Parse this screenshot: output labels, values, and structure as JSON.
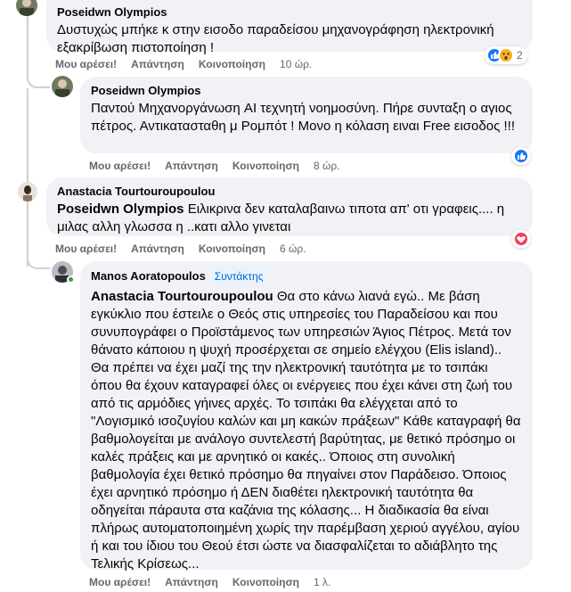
{
  "actions": {
    "like": "Μου αρέσει!",
    "reply": "Απάντηση",
    "share": "Κοινοποίηση"
  },
  "comments": [
    {
      "author": "Poseidwn Olympios",
      "text": "Δυστυχώς μπήκε κ στην εισοδο παραδείσου μηχανογράφηση ηλεκτρονική εξακρίβωση πιστοποίηση !",
      "time": "10 ώρ.",
      "reaction_count": "2"
    },
    {
      "author": "Poseidwn Olympios",
      "text": "Παντού Μηχανοργάνωση AI τεχνητή νοημοσύνη. Πήρε συνταξη ο αγιος πέτρος. Αντικατασταθη μ Ρομπότ ! Μονο η κόλαση ειναι Free εισοδος !!!",
      "time": "8 ώρ."
    },
    {
      "author": "Anastacia Tourtouroupoulou",
      "mention": "Poseidwn Olympios",
      "text": " Ειλικρινα δεν καταλαβαινω τιποτα απ' οτι γραφεις.... η μιλας αλλη γλωσσα η ..κατι αλλο γινεται",
      "time": "6 ώρ."
    },
    {
      "author": "Manos Aoratopoulos",
      "badge": "Συντάκτης",
      "mention": "Anastacia Tourtouroupoulou",
      "text": " Θα στο κάνω λιανά εγώ.. Με βάση εγκύκλιο που έστειλε ο Θεός στις υπηρεσίες του Παραδείσου και που συνυπογράφει ο Προϊστάμενος των υπηρεσιών Άγιος Πέτρος. Μετά τον θάνατο κάποιου η ψυχή προσέρχεται σε σημείο ελέγχου (Elis island).. Θα πρέπει να έχει μαζί της την ηλεκτρονική ταυτότητα με το τσιπάκι όπου θα έχουν καταγραφεί όλες οι ενέργειες που έχει κάνει στη ζωή του από τις αρμόδιες γήινες αρχές. Το τσιπάκι θα ελέγχεται από το \"Λογισμικό ισοζυγίου καλών και μη κακών πράξεων\" Κάθε καταγραφή θα βαθμολογείται με ανάλογο συντελεστή βαρύτητας, με θετικό πρόσημο οι καλές πράξεις και με αρνητικό οι κακές.. Όποιος στη συνολική βαθμολογία έχει θετικό πρόσημο θα πηγαίνει στον Παράδεισο. Όποιος έχει αρνητικό πρόσημο ή ΔΕΝ διαθέτει ηλεκτρονική ταυτότητα θα οδηγείται πάραυτα στα καζάνια της κόλασης... Η διαδικασία θα είναι πλήρως αυτοματοποιημένη χωρίς την παρέμβαση χεριού αγγέλου, αγίου ή και του ίδιου του Θεού έτσι ώστε να διασφαλίζεται το αδιάβλητο της Τελικής Κρίσεως...",
      "time": "1 λ."
    }
  ],
  "colors": {
    "like": "#1877f2",
    "love": "#f33e58",
    "wow": "#f7b125",
    "bubble": "#f0f2f5",
    "meta": "#65676b"
  }
}
